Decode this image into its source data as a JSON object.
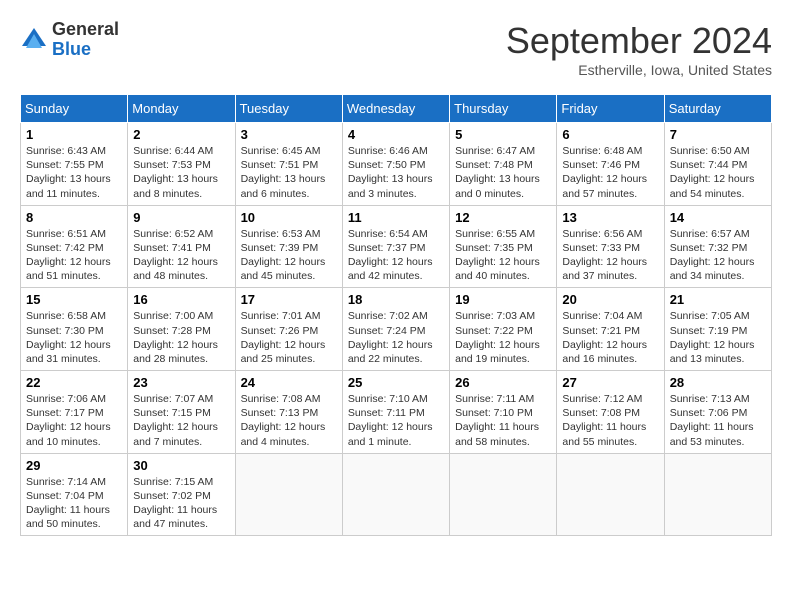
{
  "header": {
    "logo": {
      "general": "General",
      "blue": "Blue"
    },
    "title": "September 2024",
    "location": "Estherville, Iowa, United States"
  },
  "calendar": {
    "days_of_week": [
      "Sunday",
      "Monday",
      "Tuesday",
      "Wednesday",
      "Thursday",
      "Friday",
      "Saturday"
    ],
    "weeks": [
      [
        {
          "day": "1",
          "sunrise": "6:43 AM",
          "sunset": "7:55 PM",
          "daylight": "13 hours and 11 minutes."
        },
        {
          "day": "2",
          "sunrise": "6:44 AM",
          "sunset": "7:53 PM",
          "daylight": "13 hours and 8 minutes."
        },
        {
          "day": "3",
          "sunrise": "6:45 AM",
          "sunset": "7:51 PM",
          "daylight": "13 hours and 6 minutes."
        },
        {
          "day": "4",
          "sunrise": "6:46 AM",
          "sunset": "7:50 PM",
          "daylight": "13 hours and 3 minutes."
        },
        {
          "day": "5",
          "sunrise": "6:47 AM",
          "sunset": "7:48 PM",
          "daylight": "13 hours and 0 minutes."
        },
        {
          "day": "6",
          "sunrise": "6:48 AM",
          "sunset": "7:46 PM",
          "daylight": "12 hours and 57 minutes."
        },
        {
          "day": "7",
          "sunrise": "6:50 AM",
          "sunset": "7:44 PM",
          "daylight": "12 hours and 54 minutes."
        }
      ],
      [
        {
          "day": "8",
          "sunrise": "6:51 AM",
          "sunset": "7:42 PM",
          "daylight": "12 hours and 51 minutes."
        },
        {
          "day": "9",
          "sunrise": "6:52 AM",
          "sunset": "7:41 PM",
          "daylight": "12 hours and 48 minutes."
        },
        {
          "day": "10",
          "sunrise": "6:53 AM",
          "sunset": "7:39 PM",
          "daylight": "12 hours and 45 minutes."
        },
        {
          "day": "11",
          "sunrise": "6:54 AM",
          "sunset": "7:37 PM",
          "daylight": "12 hours and 42 minutes."
        },
        {
          "day": "12",
          "sunrise": "6:55 AM",
          "sunset": "7:35 PM",
          "daylight": "12 hours and 40 minutes."
        },
        {
          "day": "13",
          "sunrise": "6:56 AM",
          "sunset": "7:33 PM",
          "daylight": "12 hours and 37 minutes."
        },
        {
          "day": "14",
          "sunrise": "6:57 AM",
          "sunset": "7:32 PM",
          "daylight": "12 hours and 34 minutes."
        }
      ],
      [
        {
          "day": "15",
          "sunrise": "6:58 AM",
          "sunset": "7:30 PM",
          "daylight": "12 hours and 31 minutes."
        },
        {
          "day": "16",
          "sunrise": "7:00 AM",
          "sunset": "7:28 PM",
          "daylight": "12 hours and 28 minutes."
        },
        {
          "day": "17",
          "sunrise": "7:01 AM",
          "sunset": "7:26 PM",
          "daylight": "12 hours and 25 minutes."
        },
        {
          "day": "18",
          "sunrise": "7:02 AM",
          "sunset": "7:24 PM",
          "daylight": "12 hours and 22 minutes."
        },
        {
          "day": "19",
          "sunrise": "7:03 AM",
          "sunset": "7:22 PM",
          "daylight": "12 hours and 19 minutes."
        },
        {
          "day": "20",
          "sunrise": "7:04 AM",
          "sunset": "7:21 PM",
          "daylight": "12 hours and 16 minutes."
        },
        {
          "day": "21",
          "sunrise": "7:05 AM",
          "sunset": "7:19 PM",
          "daylight": "12 hours and 13 minutes."
        }
      ],
      [
        {
          "day": "22",
          "sunrise": "7:06 AM",
          "sunset": "7:17 PM",
          "daylight": "12 hours and 10 minutes."
        },
        {
          "day": "23",
          "sunrise": "7:07 AM",
          "sunset": "7:15 PM",
          "daylight": "12 hours and 7 minutes."
        },
        {
          "day": "24",
          "sunrise": "7:08 AM",
          "sunset": "7:13 PM",
          "daylight": "12 hours and 4 minutes."
        },
        {
          "day": "25",
          "sunrise": "7:10 AM",
          "sunset": "7:11 PM",
          "daylight": "12 hours and 1 minute."
        },
        {
          "day": "26",
          "sunrise": "7:11 AM",
          "sunset": "7:10 PM",
          "daylight": "11 hours and 58 minutes."
        },
        {
          "day": "27",
          "sunrise": "7:12 AM",
          "sunset": "7:08 PM",
          "daylight": "11 hours and 55 minutes."
        },
        {
          "day": "28",
          "sunrise": "7:13 AM",
          "sunset": "7:06 PM",
          "daylight": "11 hours and 53 minutes."
        }
      ],
      [
        {
          "day": "29",
          "sunrise": "7:14 AM",
          "sunset": "7:04 PM",
          "daylight": "11 hours and 50 minutes."
        },
        {
          "day": "30",
          "sunrise": "7:15 AM",
          "sunset": "7:02 PM",
          "daylight": "11 hours and 47 minutes."
        },
        null,
        null,
        null,
        null,
        null
      ]
    ]
  }
}
